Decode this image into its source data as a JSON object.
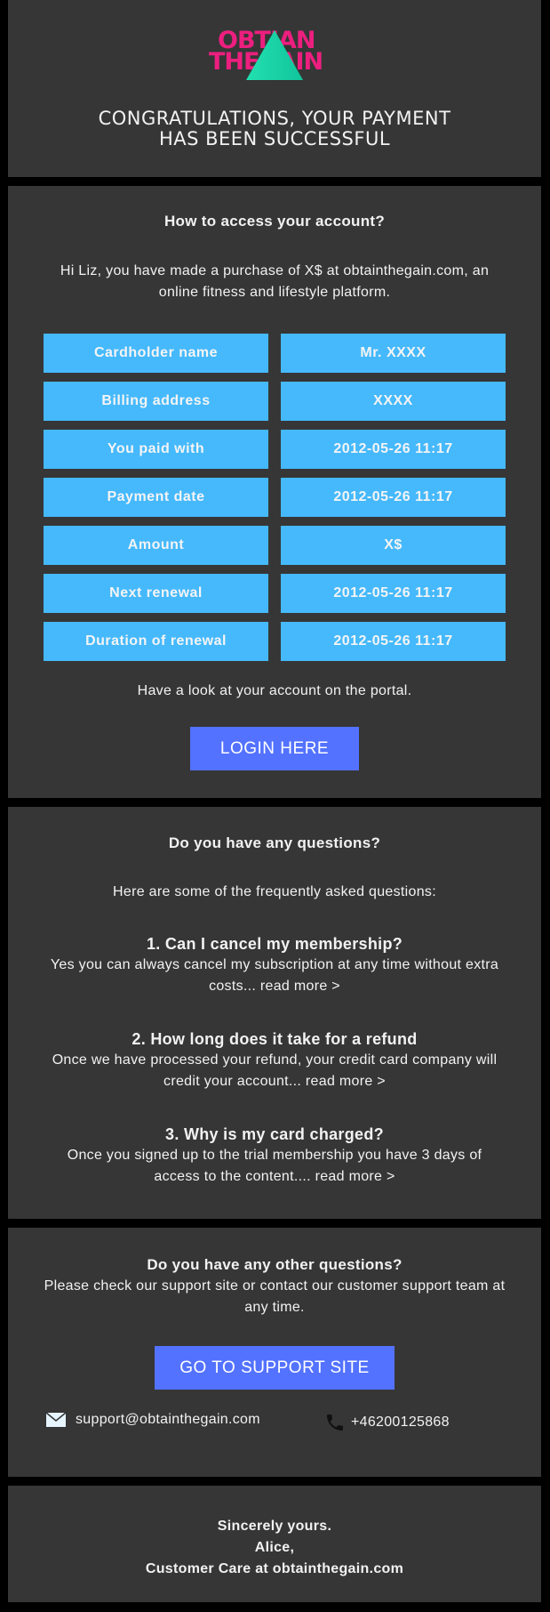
{
  "header": {
    "logo_line1": "OBTIAN",
    "logo_line2": "THEGAIN",
    "title_line1": "CONGRATULATIONS, YOUR PAYMENT",
    "title_line2": "HAS BEEN SUCCESSFUL",
    "colors": {
      "logo_pink": "#ec1f7f",
      "logo_teal": "#1fd6a8"
    }
  },
  "account": {
    "heading": "How to access your account?",
    "intro": "Hi Liz, you have made a purchase of X$ at obtainthegain.com, an online fitness and lifestyle platform.",
    "details": [
      {
        "label": "Cardholder name",
        "value": "Mr. XXXX"
      },
      {
        "label": "Billing address",
        "value": "XXXX"
      },
      {
        "label": "You paid with",
        "value": "2012-05-26 11:17"
      },
      {
        "label": "Payment date",
        "value": "2012-05-26 11:17"
      },
      {
        "label": "Amount",
        "value": "X$"
      },
      {
        "label": "Next renewal",
        "value": "2012-05-26 11:17"
      },
      {
        "label": "Duration of renewal",
        "value": "2012-05-26 11:17"
      }
    ],
    "portal_text": "Have a look at your account on the portal.",
    "login_button": "LOGIN HERE"
  },
  "faq": {
    "heading": "Do you have any questions?",
    "intro": "Here are some of the frequently asked questions:",
    "items": [
      {
        "question": "1. Can I cancel my membership?",
        "answer": "Yes you can always cancel my subscription at any time without extra costs...",
        "link": "read more >"
      },
      {
        "question": "2. How long does it take for a refund",
        "answer": "Once we have processed your refund, your credit card company will credit your account...",
        "link": "read more >"
      },
      {
        "question": "3. Why is my card charged?",
        "answer": "Once you signed up to the trial membership you have 3 days of access to the content....",
        "link": "read more >"
      }
    ]
  },
  "support": {
    "heading": "Do you have any other questions?",
    "text": "Please check our support site or contact our customer support team at any time.",
    "button": "GO TO SUPPORT SITE",
    "email": "support@obtainthegain.com",
    "phone": "+46200125868"
  },
  "signoff": {
    "line1": "Sincerely yours.",
    "line2": "Alice,",
    "line3": "Customer Care at obtainthegain.com"
  }
}
